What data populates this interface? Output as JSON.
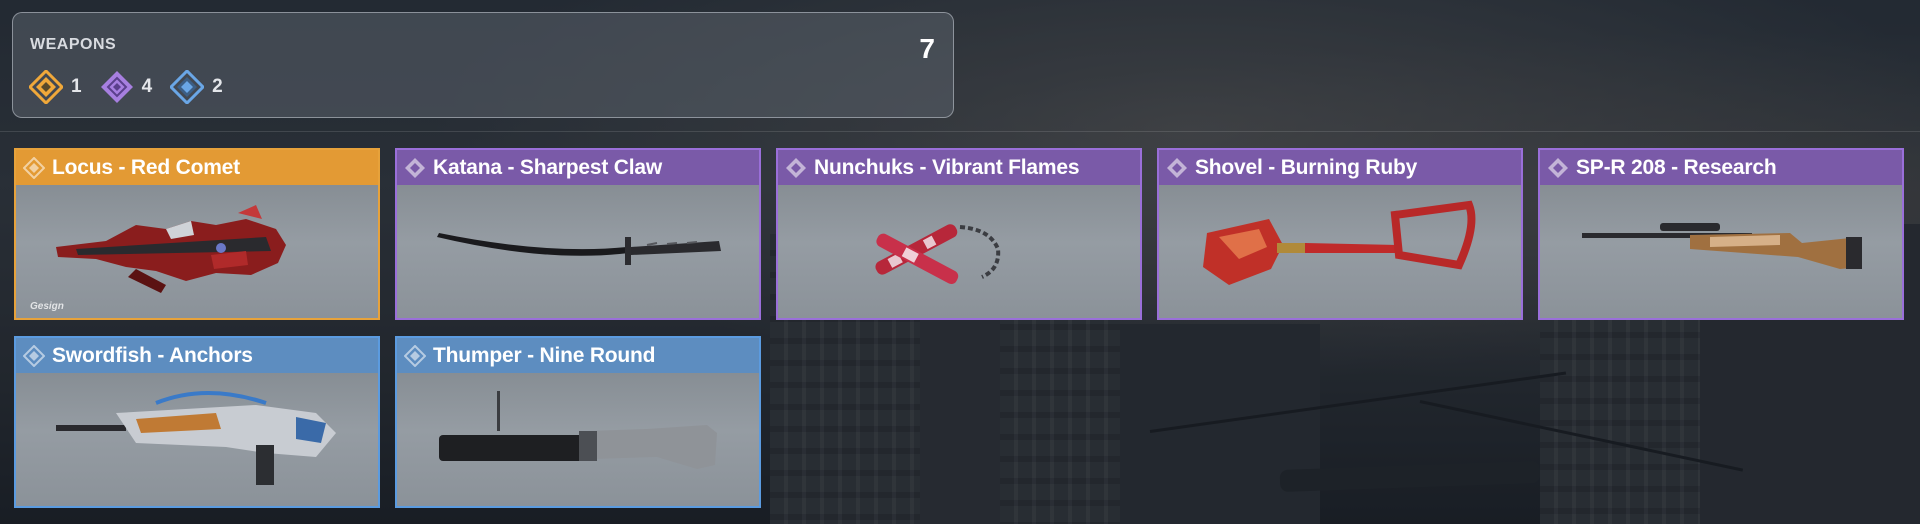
{
  "panel": {
    "title": "WEAPONS",
    "total": "7",
    "tiers": [
      {
        "name": "gold-tier",
        "count": "1",
        "color": "#f0a83a"
      },
      {
        "name": "purple-tier",
        "count": "4",
        "color": "#a77fe0"
      },
      {
        "name": "blue-tier",
        "count": "2",
        "color": "#6aa6e6"
      }
    ]
  },
  "cards": [
    {
      "title": "Locus - Red Comet",
      "rarity": "orange",
      "icon": "locus-rifle-icon"
    },
    {
      "title": "Katana - Sharpest Claw",
      "rarity": "purple",
      "icon": "katana-icon"
    },
    {
      "title": "Nunchuks - Vibrant Flames",
      "rarity": "purple",
      "icon": "nunchuks-icon"
    },
    {
      "title": "Shovel - Burning Ruby",
      "rarity": "purple",
      "icon": "shovel-icon"
    },
    {
      "title": "SP-R 208 - Research",
      "rarity": "purple",
      "icon": "sniper-rifle-icon"
    },
    {
      "title": "Swordfish - Anchors",
      "rarity": "blue",
      "icon": "swordfish-rifle-icon"
    },
    {
      "title": "Thumper - Nine Round",
      "rarity": "blue",
      "icon": "grenade-launcher-icon"
    }
  ],
  "watermark": "Gesign"
}
